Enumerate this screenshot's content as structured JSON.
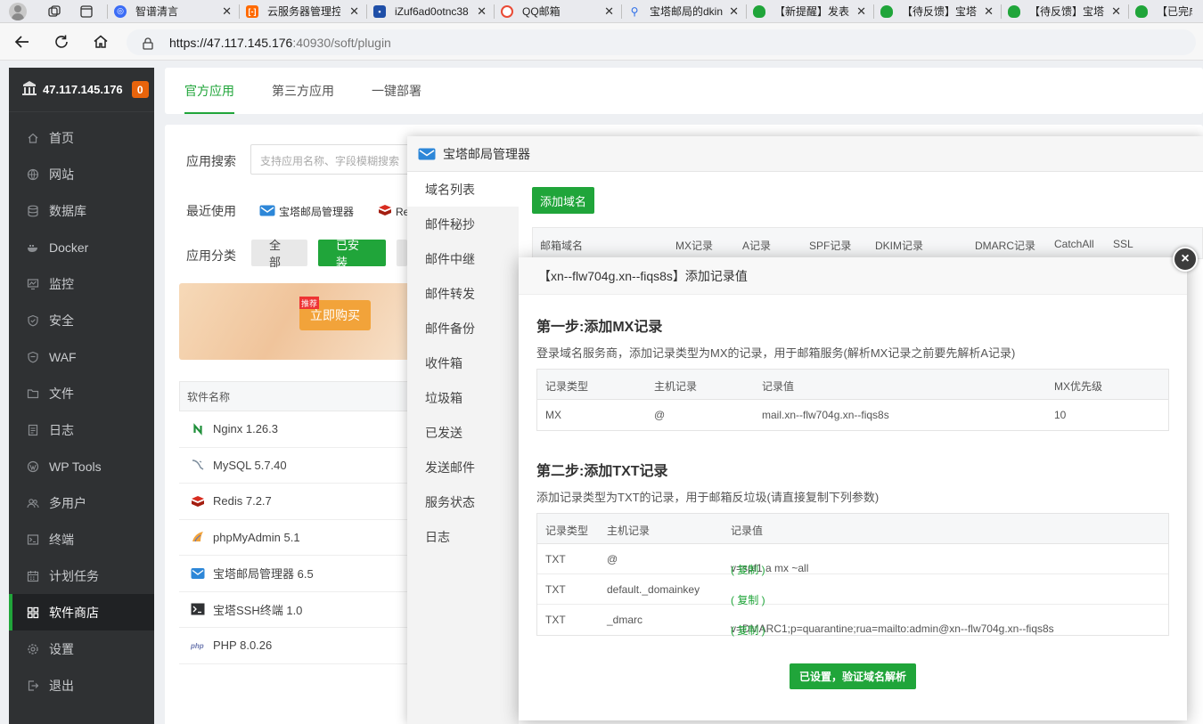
{
  "browser": {
    "tabs": [
      {
        "label": "智谱清言",
        "color": "#3b6cf6"
      },
      {
        "label": "云服务器管理控",
        "color": "#ff6a00"
      },
      {
        "label": "iZuf6ad0otnc38",
        "color": "#1f4fa8"
      },
      {
        "label": "QQ邮箱",
        "color": "#e94a35"
      },
      {
        "label": "宝塔邮局的dkin",
        "color": "#2b6de8"
      },
      {
        "label": "【新提醒】发表",
        "color": "#20a53a"
      },
      {
        "label": "【待反馈】宝塔",
        "color": "#20a53a"
      },
      {
        "label": "【待反馈】宝塔",
        "color": "#20a53a"
      },
      {
        "label": "【已完成",
        "color": "#20a53a"
      }
    ],
    "url_main": "https://47.117.145.176",
    "url_rest": ":40930/soft/plugin"
  },
  "sidebar": {
    "server_ip": "47.117.145.176",
    "badge": "0",
    "items": [
      {
        "label": "首页",
        "icon": "home-icon"
      },
      {
        "label": "网站",
        "icon": "globe-icon"
      },
      {
        "label": "数据库",
        "icon": "database-icon"
      },
      {
        "label": "Docker",
        "icon": "docker-icon"
      },
      {
        "label": "监控",
        "icon": "monitor-icon"
      },
      {
        "label": "安全",
        "icon": "shield-icon"
      },
      {
        "label": "WAF",
        "icon": "waf-shield-icon"
      },
      {
        "label": "文件",
        "icon": "folder-icon"
      },
      {
        "label": "日志",
        "icon": "log-icon"
      },
      {
        "label": "WP Tools",
        "icon": "wordpress-icon"
      },
      {
        "label": "多用户",
        "icon": "users-icon"
      },
      {
        "label": "终端",
        "icon": "terminal-icon"
      },
      {
        "label": "计划任务",
        "icon": "calendar-icon"
      },
      {
        "label": "软件商店",
        "icon": "grid-icon"
      },
      {
        "label": "设置",
        "icon": "gear-icon"
      },
      {
        "label": "退出",
        "icon": "logout-icon"
      }
    ]
  },
  "store": {
    "tabs": [
      "官方应用",
      "第三方应用",
      "一键部署"
    ],
    "search_label": "应用搜索",
    "search_placeholder": "支持应用名称、字段模糊搜索",
    "recent_label": "最近使用",
    "recent_items": [
      "宝塔邮局管理器",
      "Re"
    ],
    "category_label": "应用分类",
    "categories": [
      "全部",
      "已安装"
    ],
    "banner_tag": "推荐",
    "buy_label": "立即购买",
    "software_header": "软件名称",
    "software": [
      {
        "name": "Nginx 1.26.3",
        "icon": "nginx-icon"
      },
      {
        "name": "MySQL 5.7.40",
        "icon": "mysql-icon"
      },
      {
        "name": "Redis 7.2.7",
        "icon": "redis-icon"
      },
      {
        "name": "phpMyAdmin 5.1",
        "icon": "phpmyadmin-icon"
      },
      {
        "name": "宝塔邮局管理器 6.5",
        "icon": "mail-icon"
      },
      {
        "name": "宝塔SSH终端 1.0",
        "icon": "ssh-terminal-icon"
      },
      {
        "name": "PHP 8.0.26",
        "icon": "php-icon"
      }
    ]
  },
  "mail_manager": {
    "title": "宝塔邮局管理器",
    "menu": [
      "域名列表",
      "邮件秘抄",
      "邮件中继",
      "邮件转发",
      "邮件备份",
      "收件箱",
      "垃圾箱",
      "已发送",
      "发送邮件",
      "服务状态",
      "日志"
    ],
    "add_domain": "添加域名",
    "columns": [
      "邮箱域名",
      "MX记录",
      "A记录",
      "SPF记录",
      "DKIM记录",
      "DMARC记录",
      "CatchAll",
      "SSL"
    ]
  },
  "dialog": {
    "title": "【xn--flw704g.xn--fiqs8s】添加记录值",
    "step1_title": "第一步:添加MX记录",
    "step1_desc": "登录域名服务商，添加记录类型为MX的记录，用于邮箱服务(解析MX记录之前要先解析A记录)",
    "mx_headers": [
      "记录类型",
      "主机记录",
      "记录值",
      "MX优先级"
    ],
    "mx_row": [
      "MX",
      "@",
      "mail.xn--flw704g.xn--fiqs8s",
      "10"
    ],
    "step2_title": "第二步:添加TXT记录",
    "step2_desc": "添加记录类型为TXT的记录，用于邮箱反垃圾(请直接复制下列参数)",
    "txt_headers": [
      "记录类型",
      "主机记录",
      "记录值"
    ],
    "txt_rows": [
      {
        "type": "TXT",
        "host": "@",
        "value": "v=spf1 a mx ~all",
        "copy": "( 复制 )"
      },
      {
        "type": "TXT",
        "host": "default._domainkey",
        "value": "",
        "copy": "( 复制 )"
      },
      {
        "type": "TXT",
        "host": "_dmarc",
        "value": "v=DMARC1;p=quarantine;rua=mailto:admin@xn--flw704g.xn--fiqs8s",
        "copy": "( 复制 )"
      }
    ],
    "verify_button": "已设置，验证域名解析",
    "close": "×"
  }
}
